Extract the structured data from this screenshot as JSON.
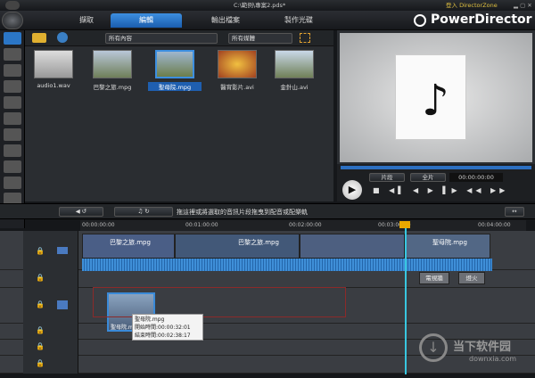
{
  "window": {
    "title": "C:\\範例\\專案2.pds*",
    "login": "登入 DirectorZone"
  },
  "tabs": [
    {
      "label": "擷取"
    },
    {
      "label": "編輯",
      "active": true
    },
    {
      "label": "輸出檔案"
    },
    {
      "label": "製作光碟"
    }
  ],
  "brand": "PowerDirector",
  "library": {
    "filter_content": "所有內容",
    "filter_media": "所有媒體",
    "items": [
      {
        "label": "audio1.wav",
        "icon": "music-note-icon"
      },
      {
        "label": "巴黎之旅.mpg"
      },
      {
        "label": "聖母院.mpg",
        "selected": true
      },
      {
        "label": "醫宵影片.avi"
      },
      {
        "label": "金針山.avi"
      }
    ]
  },
  "preview": {
    "segment": "片段",
    "full": "全片",
    "timecode": "00:00:00:00"
  },
  "timeline": {
    "hint": "拖這裡或將選取的音訊片段拖曳到配音或配樂軌",
    "ruler": [
      "00:00:00:00",
      "00:01:00:00",
      "00:02:00:00",
      "00:03:00:00",
      "00:04:00:00"
    ],
    "clip1": "巴黎之旅.mpg",
    "clip2": "巴黎之旅.mpg",
    "clip3": "聖母院.mpg",
    "fx1": "電視牆",
    "fx2": "燈火",
    "dragged": "聖母院.mpg"
  },
  "tooltip": {
    "name": "聖母院.mpg",
    "start": "開始時間:00:00:32:01",
    "end": "結束時間:00:02:38:17"
  },
  "watermark": {
    "text": "当下软件园",
    "url": "downxia.com"
  }
}
